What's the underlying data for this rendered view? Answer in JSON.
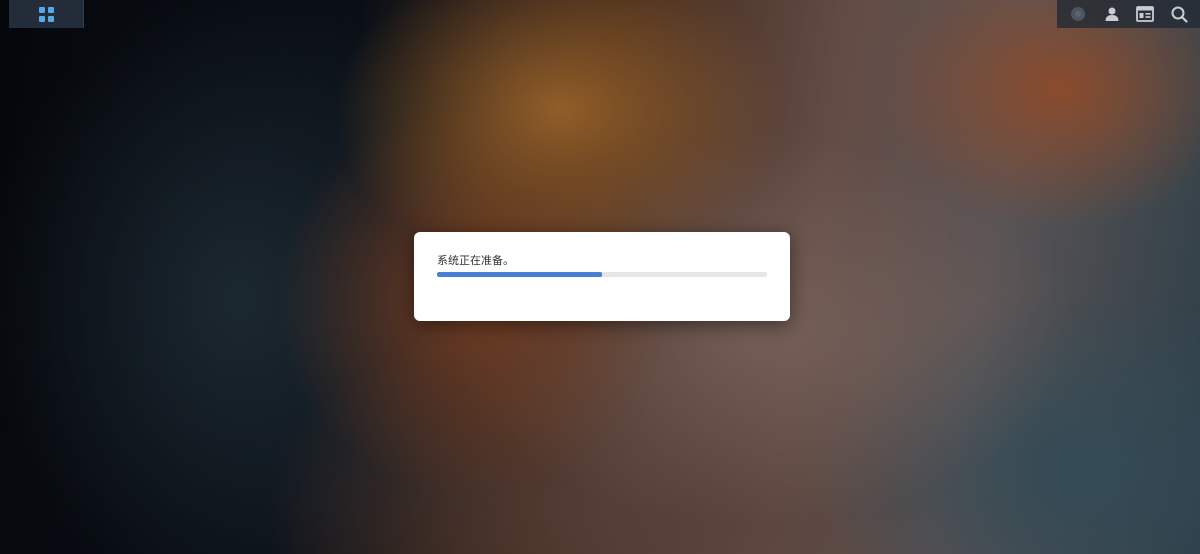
{
  "desktop": {
    "wallpaper": "canyon"
  },
  "taskbar": {
    "main_menu_icon": "grid-icon",
    "right_icons": [
      "notification-icon",
      "user-icon",
      "widgets-icon",
      "search-icon"
    ]
  },
  "modal": {
    "message": "系统正在准备。",
    "progress": 0.5
  },
  "colors": {
    "accent": "#4a7fd4",
    "taskbar_icon": "#5aa7e6",
    "modal_bg": "#ffffff"
  }
}
